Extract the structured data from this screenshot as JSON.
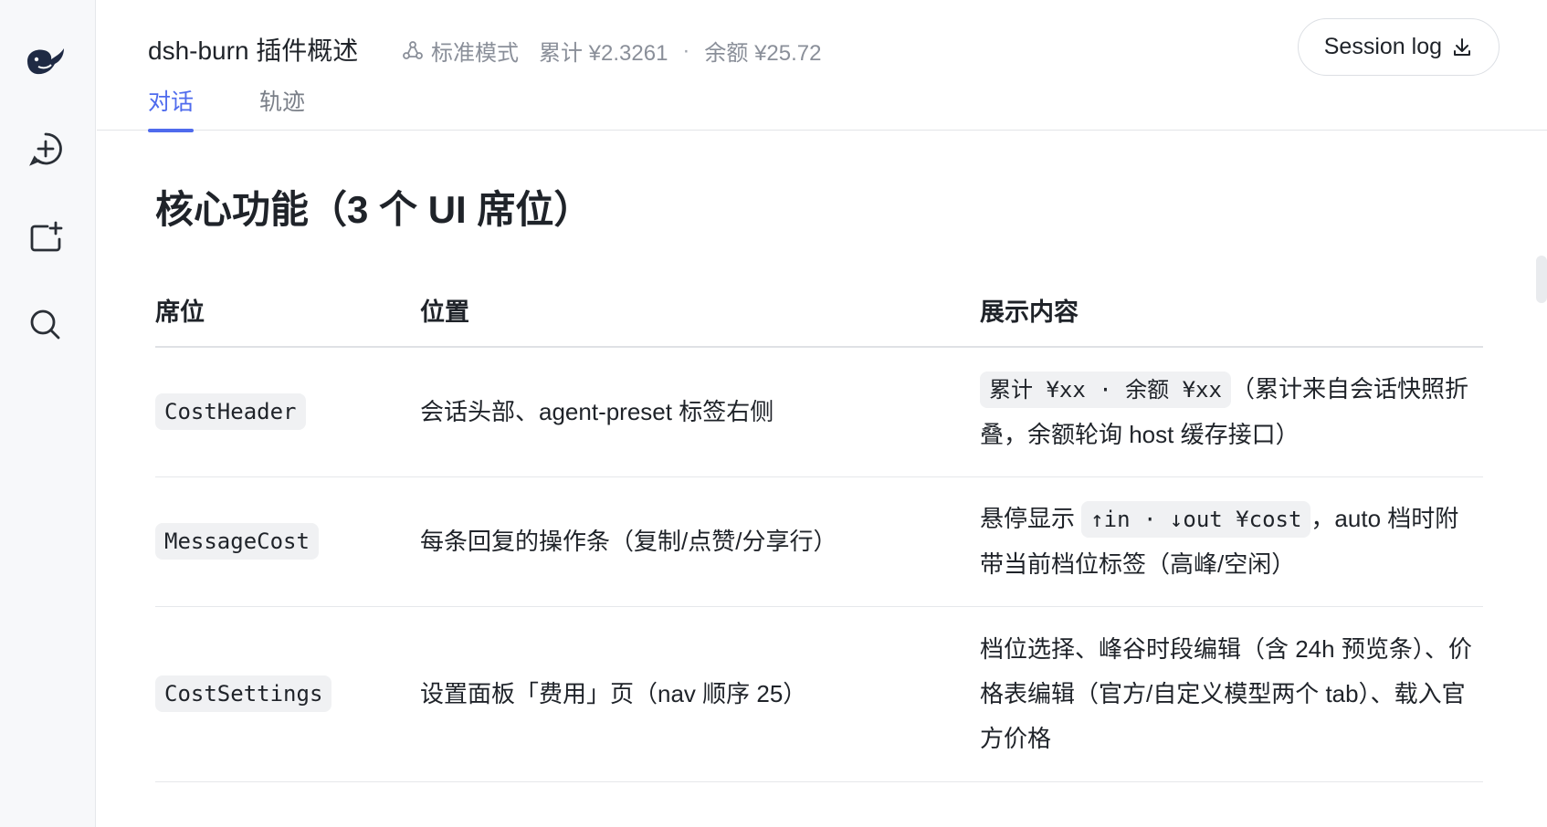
{
  "header": {
    "title": "dsh-burn 插件概述",
    "mode": "标准模式",
    "cumulative": "累计 ¥2.3261",
    "separator": "·",
    "balance": "余额 ¥25.72",
    "session_button": "Session log"
  },
  "tabs": [
    {
      "label": "对话",
      "active": true
    },
    {
      "label": "轨迹",
      "active": false
    }
  ],
  "content": {
    "heading": "核心功能（3 个 UI 席位）",
    "table": {
      "columns": [
        "席位",
        "位置",
        "展示内容"
      ],
      "rows": [
        {
          "slot": "CostHeader",
          "location": "会话头部、agent-preset 标签右侧",
          "display_code": "累计 ¥xx · 余额 ¥xx",
          "display_text": "（累计来自会话快照折叠，余额轮询 host 缓存接口）"
        },
        {
          "slot": "MessageCost",
          "location": "每条回复的操作条（复制/点赞/分享行）",
          "display_prefix": "悬停显示 ",
          "display_code": "↑in · ↓out ¥cost",
          "display_text": "，auto 档时附带当前档位标签（高峰/空闲）"
        },
        {
          "slot": "CostSettings",
          "location": "设置面板「费用」页（nav 顺序 25）",
          "display_text": "档位选择、峰谷时段编辑（含 24h 预览条）、价格表编辑（官方/自定义模型两个 tab）、载入官方价格"
        }
      ]
    }
  },
  "sidebar": {
    "icons": [
      "whale-logo-icon",
      "new-chat-icon",
      "new-folder-icon",
      "search-icon"
    ]
  },
  "colors": {
    "accent": "#4f6bed",
    "text": "#1f2329",
    "muted": "#8a8f99",
    "code_bg": "#f0f1f3"
  }
}
